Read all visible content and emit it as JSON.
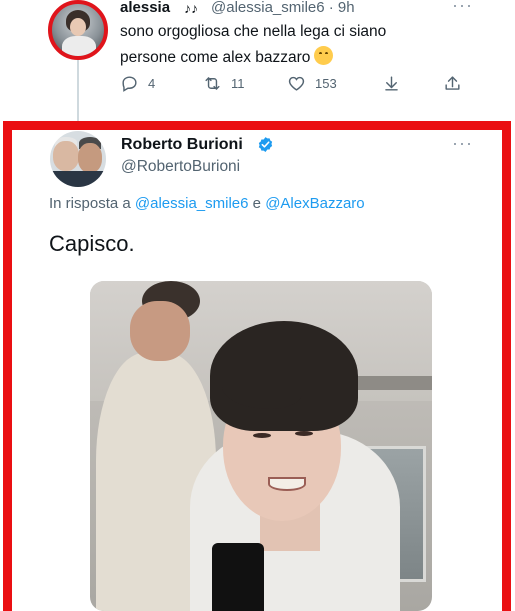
{
  "parent_tweet": {
    "name": "alessia",
    "name_decoration": "♪♪",
    "handle_time": "@alessia_smile6 · 9h",
    "more": "···",
    "text": "sono orgogliosa che nella lega ci siano persone come alex bazzaro",
    "emoji": "hugging-face-emoji",
    "actions": {
      "reply_count": "4",
      "retweet_count": "11",
      "like_count": "153"
    }
  },
  "reply_tweet": {
    "name": "Roberto Burioni",
    "handle": "@RobertoBurioni",
    "more": "···",
    "reply_prefix": "In risposta a",
    "mention_1": "@alessia_smile6",
    "conjunction": "e",
    "mention_2": "@AlexBazzaro",
    "text": "Capisco."
  },
  "colors": {
    "highlight_frame": "#ea0f12",
    "link": "#1d9bf0",
    "secondary_text": "#536471",
    "verified": "#1d9bf0"
  }
}
